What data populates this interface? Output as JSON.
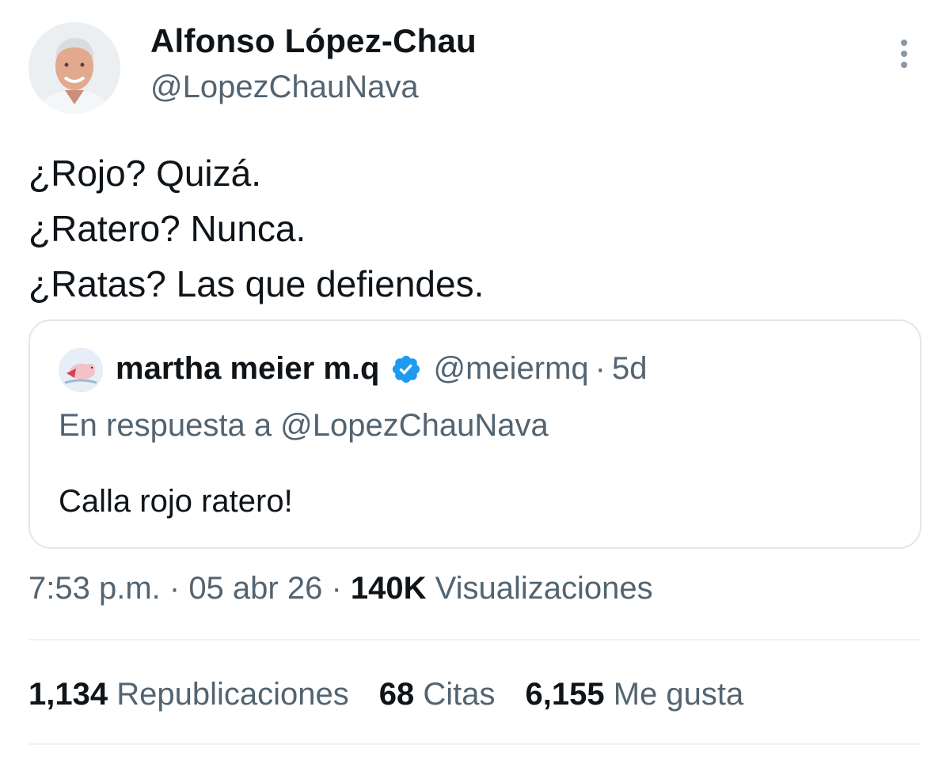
{
  "author": {
    "name": "Alfonso López-Chau",
    "handle": "@LopezChauNava"
  },
  "tweet": {
    "lines": [
      "¿Rojo? Quizá.",
      "¿Ratero? Nunca.",
      "¿Ratas? Las que defiendes."
    ]
  },
  "quote": {
    "name": "martha meier m.q",
    "handle": "@meiermq",
    "separator": "·",
    "time": "5d",
    "reply_to": "En respuesta a @LopezChauNava",
    "text": "Calla rojo ratero!"
  },
  "meta": {
    "time": "7:53 p.m.",
    "sep1": " · ",
    "date": "05 abr 26",
    "sep2": " · ",
    "views_count": "140K",
    "views_label": "Visualizaciones"
  },
  "stats": {
    "reposts_count": "1,134",
    "reposts_label": "Republicaciones",
    "quotes_count": "68",
    "quotes_label": "Citas",
    "likes_count": "6,155",
    "likes_label": "Me gusta"
  },
  "colors": {
    "text_primary": "#0f1419",
    "text_secondary": "#536471",
    "verified": "#1d9bf0",
    "border": "#e2e7eb"
  },
  "icons": {
    "more": "vertical-dots-icon",
    "verified": "verified-badge-icon"
  }
}
